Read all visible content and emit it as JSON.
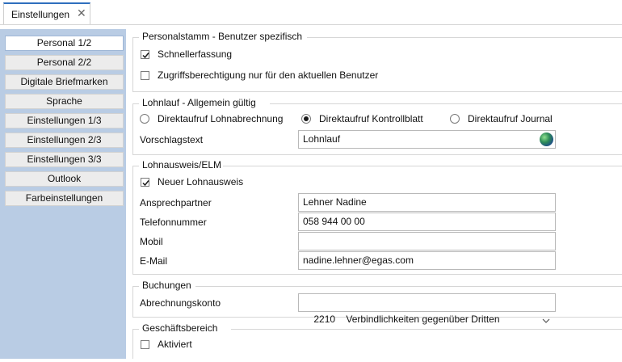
{
  "tab": {
    "label": "Einstellungen",
    "close": "✕"
  },
  "sidebar": {
    "items": [
      {
        "label": "Personal 1/2"
      },
      {
        "label": "Personal 2/2"
      },
      {
        "label": "Digitale Briefmarken"
      },
      {
        "label": "Sprache"
      },
      {
        "label": "Einstellungen 1/3"
      },
      {
        "label": "Einstellungen 2/3"
      },
      {
        "label": "Einstellungen 3/3"
      },
      {
        "label": "Outlook"
      },
      {
        "label": "Farbeinstellungen"
      }
    ],
    "active_index": 0
  },
  "personalstamm": {
    "title": "Personalstamm - Benutzer spezifisch",
    "schnellerfassung": {
      "label": "Schnellerfassung",
      "checked": true
    },
    "zugriff": {
      "label": "Zugriffsberechtigung nur für den aktuellen Benutzer",
      "checked": false
    }
  },
  "lohnlauf": {
    "title": "Lohnlauf - Allgemein gültig",
    "radios": [
      {
        "label": "Direktaufruf Lohnabrechnung",
        "selected": false
      },
      {
        "label": "Direktaufruf Kontrollblatt",
        "selected": true
      },
      {
        "label": "Direktaufruf Journal",
        "selected": false
      }
    ],
    "vorschlagstext_label": "Vorschlagstext",
    "vorschlagstext_value": "Lohnlauf"
  },
  "lohnausweis": {
    "title": "Lohnausweis/ELM",
    "neuer": {
      "label": "Neuer Lohnausweis",
      "checked": true
    },
    "ansprechpartner_label": "Ansprechpartner",
    "ansprechpartner_value": "Lehner Nadine",
    "telefon_label": "Telefonnummer",
    "telefon_value": "058 944 00 00",
    "mobil_label": "Mobil",
    "mobil_value": "",
    "email_label": "E-Mail",
    "email_value": "nadine.lehner@egas.com"
  },
  "buchungen": {
    "title": "Buchungen",
    "konto_label": "Abrechnungskonto",
    "konto_value": "2210    Verbindlichkeiten gegenüber Dritten"
  },
  "geschaeftsbereich": {
    "title": "Geschäftsbereich",
    "aktiviert": {
      "label": "Aktiviert",
      "checked": false
    }
  },
  "colors": {
    "sidebar_bg": "#b9cce4",
    "tab_accent": "#2f6fbe"
  }
}
